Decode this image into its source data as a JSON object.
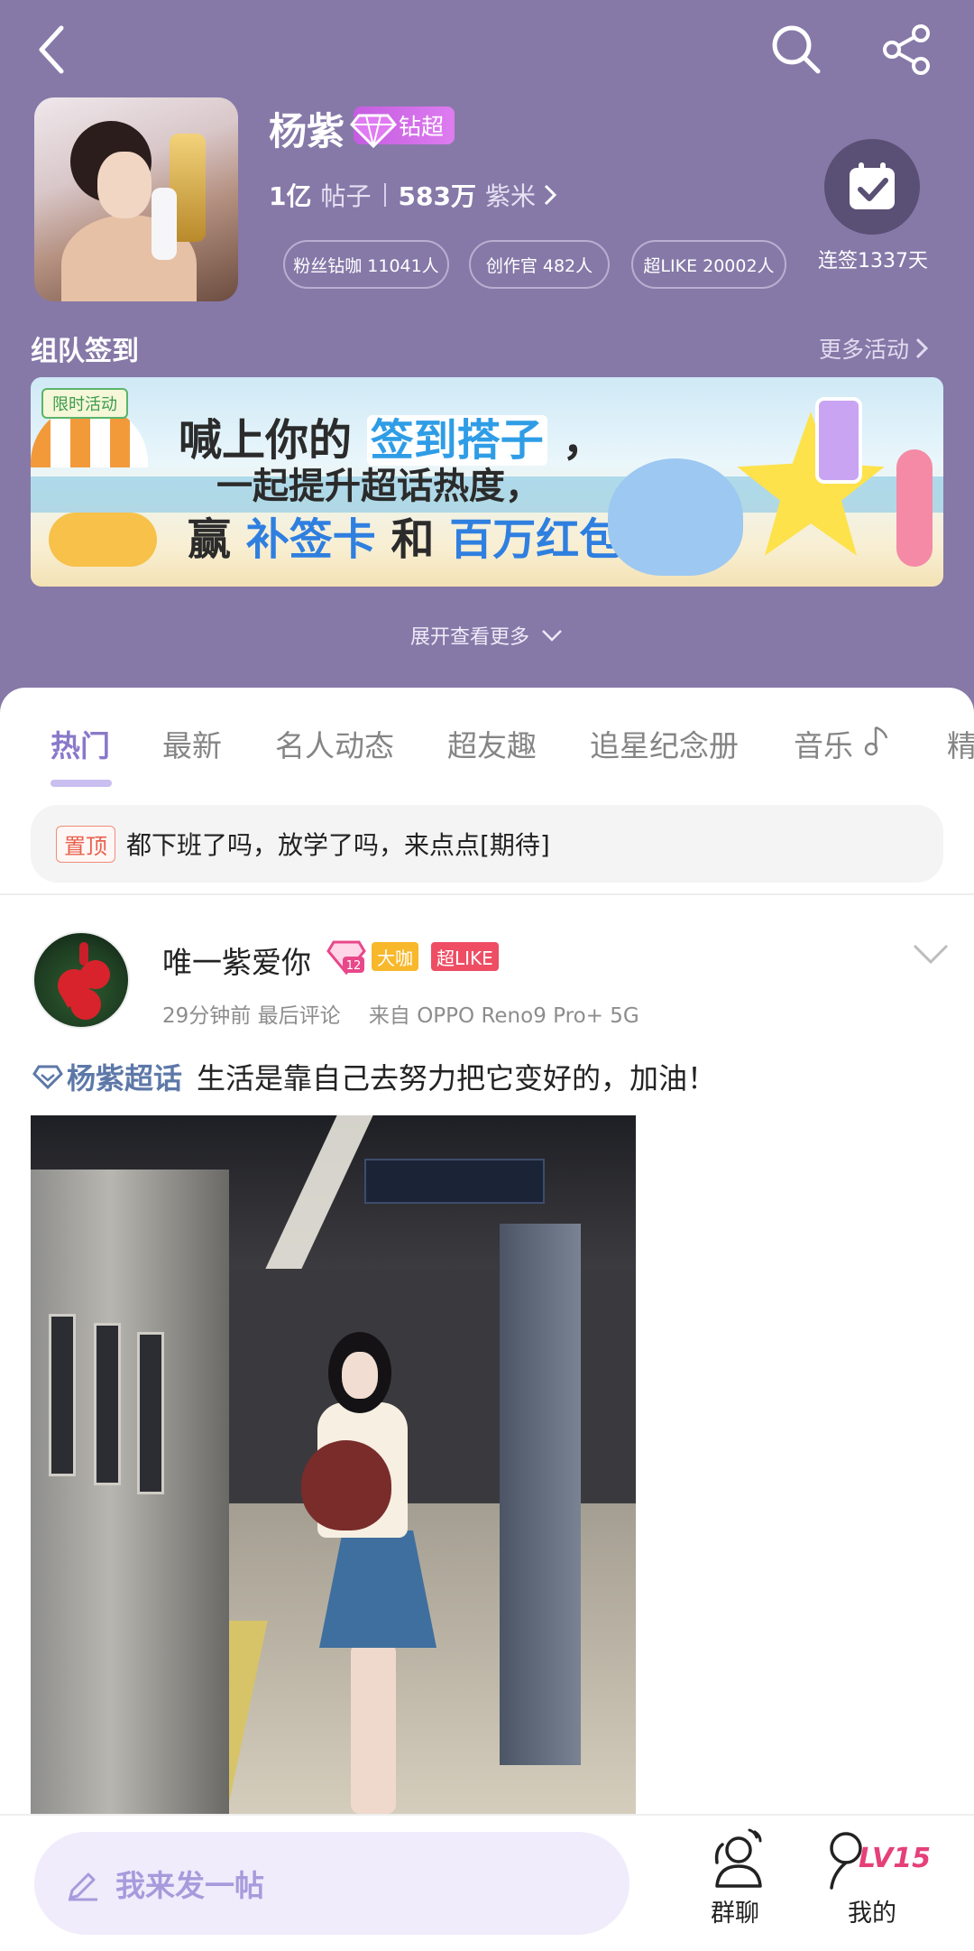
{
  "profile": {
    "name": "杨紫",
    "badge": "钻超",
    "posts_count": "1亿",
    "posts_label": "帖子",
    "fans_count": "583万",
    "fans_label": "紫米",
    "chips": [
      "粉丝钻咖 11041人",
      "创作官 482人",
      "超LIKE 20002人"
    ],
    "checkin_label": "连签1337天"
  },
  "activities": {
    "title": "组队签到",
    "more": "更多活动",
    "banner": {
      "tag": "限时活动",
      "line1_prefix": "喊上你的",
      "line1_highlight": "签到搭子",
      "line1_suffix": "，",
      "line2": "一起提升超话热度，",
      "line3_prefix": "赢",
      "line3_blue1": "补签卡",
      "line3_mid": "和",
      "line3_blue2": "百万红包"
    },
    "expand": "展开查看更多"
  },
  "tabs": [
    "热门",
    "最新",
    "名人动态",
    "超友趣",
    "追星纪念册",
    "音乐",
    "精"
  ],
  "active_tab": "热门",
  "pinned": {
    "tag": "置顶",
    "text": "都下班了吗，放学了吗，来点点[期待]"
  },
  "post": {
    "author": "唯一紫爱你",
    "level": "12",
    "tag_daka": "大咖",
    "tag_like": "超LIKE",
    "time": "29分钟前 最后评论",
    "source": "来自 OPPO Reno9 Pro+ 5G",
    "topic": "杨紫超话",
    "text": "生活是靠自己去努力把它变好的，加油！"
  },
  "bottom": {
    "compose_placeholder": "我来发一帖",
    "group_chat": "群聊",
    "mine": "我的",
    "level": "LV15"
  },
  "colors": {
    "header_bg": "#8679a8",
    "accent": "#8a79c9",
    "compose_bg": "#f0ecfc"
  }
}
